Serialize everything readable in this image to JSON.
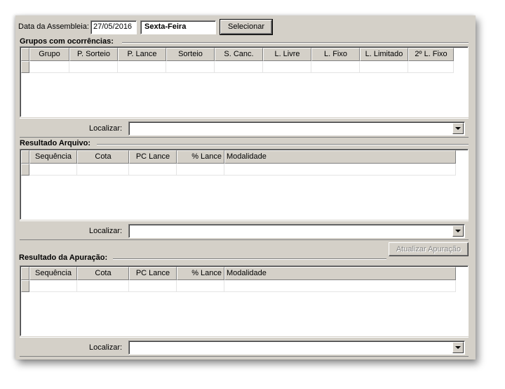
{
  "header": {
    "date_label": "Data da Assembleia:",
    "date_value": "27/05/2016",
    "weekday": "Sexta-Feira",
    "select_button": "Selecionar"
  },
  "grupos": {
    "title": "Grupos com ocorrências:",
    "columns": [
      "Grupo",
      "P. Sorteio",
      "P. Lance",
      "Sorteio",
      "S. Canc.",
      "L. Livre",
      "L. Fixo",
      "L. Limitado",
      "2º L. Fixo"
    ],
    "search_label": "Localizar:",
    "search_value": ""
  },
  "arquivo": {
    "title": "Resultado Arquivo:",
    "columns": [
      "Sequência",
      "Cota",
      "PC Lance",
      "% Lance",
      "Modalidade"
    ],
    "search_label": "Localizar:",
    "search_value": ""
  },
  "apuracao": {
    "title": "Resultado da Apuração:",
    "update_button": "Atualizar Apuração",
    "columns": [
      "Sequência",
      "Cota",
      "PC Lance",
      "% Lance",
      "Modalidade"
    ],
    "search_label": "Localizar:",
    "search_value": ""
  }
}
